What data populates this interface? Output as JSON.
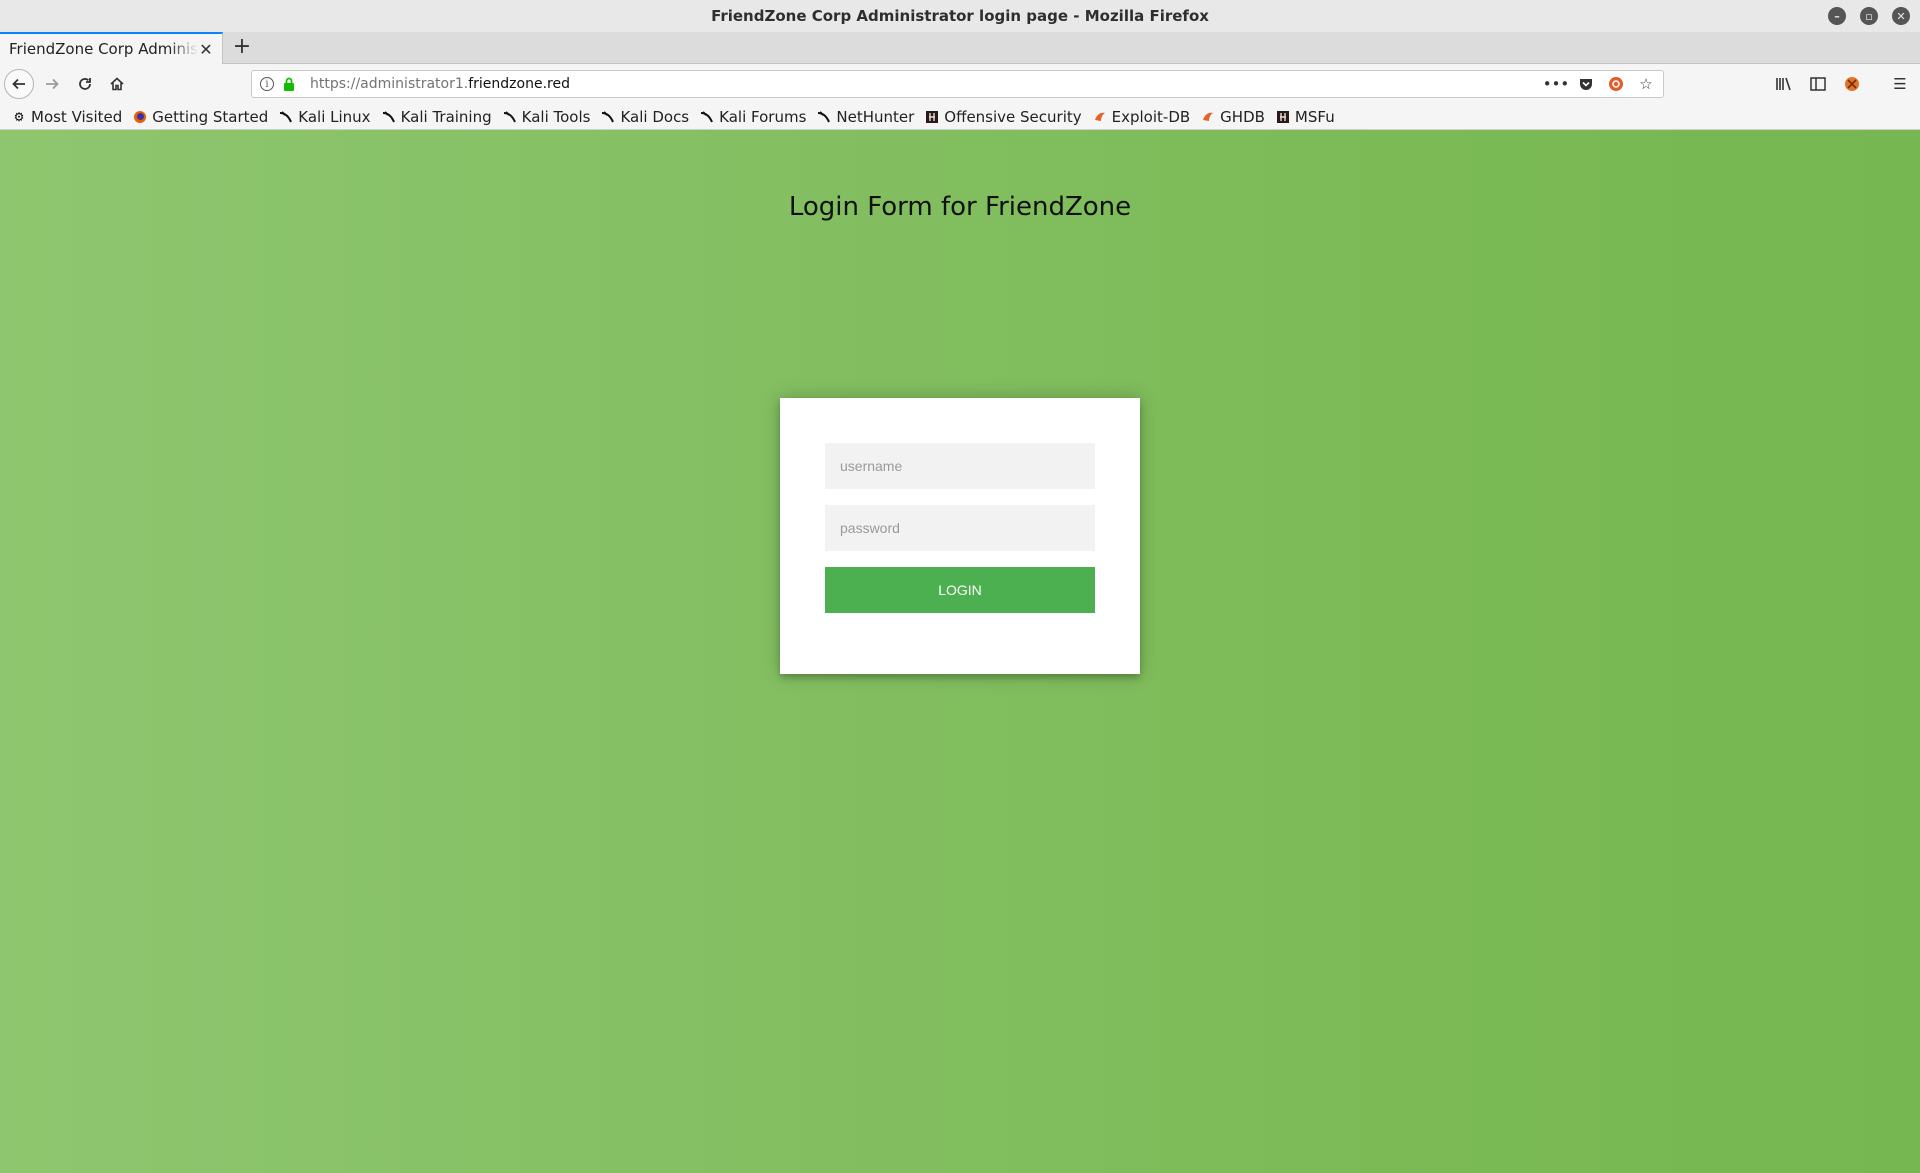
{
  "window": {
    "title": "FriendZone Corp Administrator login page - Mozilla Firefox"
  },
  "tabs": [
    {
      "label": "FriendZone Corp Administrator login page",
      "active": true
    }
  ],
  "urlbar": {
    "prefix": "https://administrator1.",
    "domain": "friendzone.red"
  },
  "bookmarks": [
    {
      "label": "Most Visited",
      "icon": "gear-icon"
    },
    {
      "label": "Getting Started",
      "icon": "firefox-icon"
    },
    {
      "label": "Kali Linux",
      "icon": "kali-dragon-icon"
    },
    {
      "label": "Kali Training",
      "icon": "kali-dragon-icon"
    },
    {
      "label": "Kali Tools",
      "icon": "kali-dragon-icon"
    },
    {
      "label": "Kali Docs",
      "icon": "kali-dragon-icon"
    },
    {
      "label": "Kali Forums",
      "icon": "kali-dragon-icon"
    },
    {
      "label": "NetHunter",
      "icon": "kali-dragon-icon"
    },
    {
      "label": "Offensive Security",
      "icon": "offsec-icon"
    },
    {
      "label": "Exploit-DB",
      "icon": "exploitdb-icon"
    },
    {
      "label": "GHDB",
      "icon": "exploitdb-icon"
    },
    {
      "label": "MSFu",
      "icon": "offsec-icon"
    }
  ],
  "page": {
    "heading": "Login Form for FriendZone",
    "username_placeholder": "username",
    "password_placeholder": "password",
    "login_label": "LOGIN"
  },
  "colors": {
    "background_green": "#85c064",
    "button_green": "#4caf50",
    "tab_accent": "#0a84ff"
  }
}
